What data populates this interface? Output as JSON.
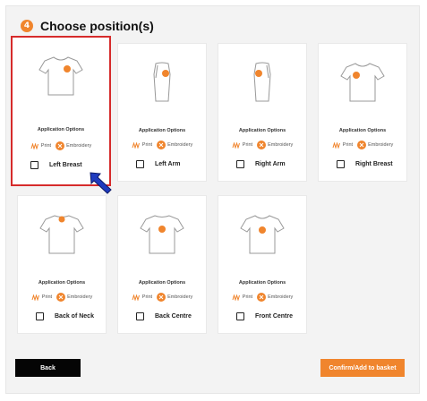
{
  "header": {
    "step_number": "4",
    "title": "Choose position(s)"
  },
  "application_options_label": "Application Options",
  "option_print_label": "Print",
  "option_embroidery_label": "Embroidery",
  "colors": {
    "accent": "#f0852d",
    "selected_border": "#d62b2b",
    "arrow": "#1f3bbf"
  },
  "positions": [
    {
      "label": "Left Breast",
      "view": "front",
      "selected": true,
      "checked": false
    },
    {
      "label": "Left Arm",
      "view": "side",
      "selected": false,
      "checked": false
    },
    {
      "label": "Right Arm",
      "view": "side",
      "selected": false,
      "checked": false
    },
    {
      "label": "Right Breast",
      "view": "front",
      "selected": false,
      "checked": false
    },
    {
      "label": "Back of Neck",
      "view": "back",
      "selected": false,
      "checked": false
    },
    {
      "label": "Back Centre",
      "view": "back",
      "selected": false,
      "checked": false
    },
    {
      "label": "Front Centre",
      "view": "front",
      "selected": false,
      "checked": false
    }
  ],
  "buttons": {
    "back_label": "Back",
    "confirm_label": "Confirm/Add to basket"
  }
}
